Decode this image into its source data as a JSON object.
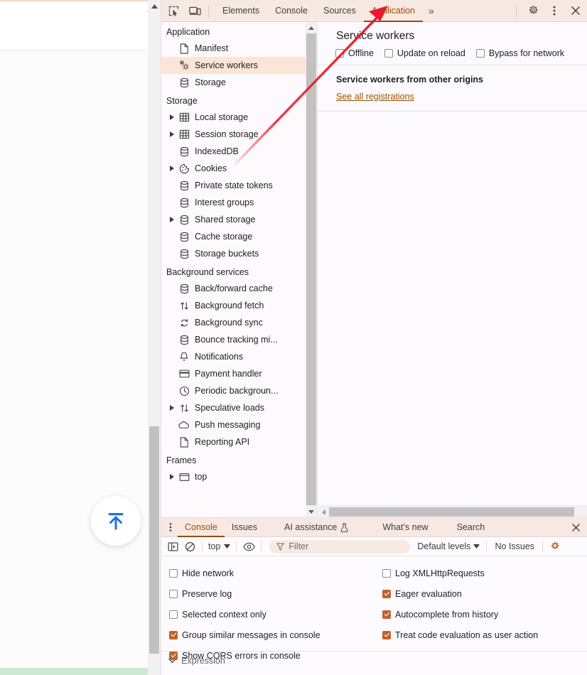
{
  "toolbar": {
    "inspect_icon": "inspect-element-icon",
    "device_icon": "device-toolbar-icon",
    "tabs": [
      {
        "label": "Elements",
        "active": false
      },
      {
        "label": "Console",
        "active": false
      },
      {
        "label": "Sources",
        "active": false
      },
      {
        "label": "Application",
        "active": true
      }
    ],
    "more_tabs_label": "»",
    "settings_icon": "gear-icon",
    "menu_icon": "more-vertical-icon",
    "close_icon": "close-icon",
    "active_tab_color": "#a64b00",
    "background_color": "#f7e9e2"
  },
  "sidebar": {
    "sections": [
      {
        "title": "Application",
        "items": [
          {
            "label": "Manifest",
            "icon": "document-icon",
            "twisty": false,
            "selected": false
          },
          {
            "label": "Service workers",
            "icon": "service-worker-icon",
            "twisty": false,
            "selected": true
          },
          {
            "label": "Storage",
            "icon": "database-icon",
            "twisty": false,
            "selected": false
          }
        ]
      },
      {
        "title": "Storage",
        "items": [
          {
            "label": "Local storage",
            "icon": "table-icon",
            "twisty": true,
            "selected": false
          },
          {
            "label": "Session storage",
            "icon": "table-icon",
            "twisty": true,
            "selected": false
          },
          {
            "label": "IndexedDB",
            "icon": "database-icon",
            "twisty": false,
            "selected": false
          },
          {
            "label": "Cookies",
            "icon": "cookie-icon",
            "twisty": true,
            "selected": false
          },
          {
            "label": "Private state tokens",
            "icon": "database-icon",
            "twisty": false,
            "selected": false
          },
          {
            "label": "Interest groups",
            "icon": "database-icon",
            "twisty": false,
            "selected": false
          },
          {
            "label": "Shared storage",
            "icon": "database-icon",
            "twisty": true,
            "selected": false
          },
          {
            "label": "Cache storage",
            "icon": "database-icon",
            "twisty": false,
            "selected": false
          },
          {
            "label": "Storage buckets",
            "icon": "database-icon",
            "twisty": false,
            "selected": false
          }
        ]
      },
      {
        "title": "Background services",
        "items": [
          {
            "label": "Back/forward cache",
            "icon": "database-icon",
            "twisty": false,
            "selected": false
          },
          {
            "label": "Background fetch",
            "icon": "arrows-up-down-icon",
            "twisty": false,
            "selected": false
          },
          {
            "label": "Background sync",
            "icon": "sync-icon",
            "twisty": false,
            "selected": false
          },
          {
            "label": "Bounce tracking mi...",
            "icon": "database-icon",
            "twisty": false,
            "selected": false
          },
          {
            "label": "Notifications",
            "icon": "bell-icon",
            "twisty": false,
            "selected": false
          },
          {
            "label": "Payment handler",
            "icon": "credit-card-icon",
            "twisty": false,
            "selected": false
          },
          {
            "label": "Periodic backgroun...",
            "icon": "clock-icon",
            "twisty": false,
            "selected": false
          },
          {
            "label": "Speculative loads",
            "icon": "arrows-up-down-icon",
            "twisty": true,
            "selected": false
          },
          {
            "label": "Push messaging",
            "icon": "cloud-icon",
            "twisty": false,
            "selected": false
          },
          {
            "label": "Reporting API",
            "icon": "document-icon",
            "twisty": false,
            "selected": false
          }
        ]
      },
      {
        "title": "Frames",
        "items": [
          {
            "label": "top",
            "icon": "frame-icon",
            "twisty": true,
            "selected": false
          }
        ]
      }
    ],
    "selected_highlight_color": "#fbe5d6"
  },
  "main": {
    "title": "Service workers",
    "controls": [
      {
        "label": "Offline",
        "checked": false
      },
      {
        "label": "Update on reload",
        "checked": false
      },
      {
        "label": "Bypass for network",
        "checked": false
      }
    ],
    "other_origins_heading": "Service workers from other origins",
    "see_all_link": "See all registrations"
  },
  "drawer": {
    "tabs": [
      {
        "label": "Console",
        "active": true,
        "icon": null
      },
      {
        "label": "Issues",
        "active": false,
        "icon": null
      },
      {
        "label": "AI assistance",
        "active": false,
        "icon": "flask-icon"
      },
      {
        "label": "What's new",
        "active": false,
        "icon": null
      },
      {
        "label": "Search",
        "active": false,
        "icon": null
      }
    ],
    "close_icon": "close-icon",
    "menu_icon": "more-vertical-icon",
    "console_toolbar": {
      "sidebar_toggle_icon": "console-sidebar-icon",
      "clear_icon": "clear-console-icon",
      "context": "top",
      "live_expression_icon": "eye-icon",
      "filter_placeholder": "Filter",
      "filter_icon": "filter-icon",
      "levels": "Default levels",
      "issues": "No Issues",
      "settings_icon": "gear-icon"
    },
    "settings_left": [
      {
        "label": "Hide network",
        "checked": false
      },
      {
        "label": "Preserve log",
        "checked": false
      },
      {
        "label": "Selected context only",
        "checked": false
      },
      {
        "label": "Group similar messages in console",
        "checked": true
      },
      {
        "label": "Show CORS errors in console",
        "checked": true
      }
    ],
    "settings_right": [
      {
        "label": "Log XMLHttpRequests",
        "checked": false
      },
      {
        "label": "Eager evaluation",
        "checked": true
      },
      {
        "label": "Autocomplete from history",
        "checked": true
      },
      {
        "label": "Treat code evaluation as user action",
        "checked": true
      }
    ],
    "expression_row_label": "Expression",
    "checked_color": "#c2622a"
  },
  "page": {
    "scroll_to_top_icon": "scroll-to-top-icon",
    "scroll_to_top_color": "#1a73e8"
  },
  "annotation": {
    "arrow_color": "#e8192c",
    "arrow_from": "355,215",
    "arrow_to": "545,9"
  }
}
